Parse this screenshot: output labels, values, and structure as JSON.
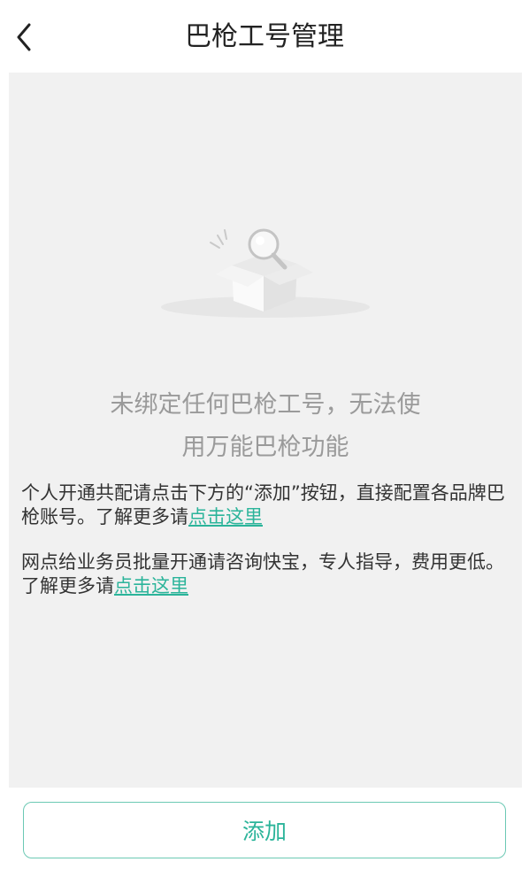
{
  "header": {
    "title": "巴枪工号管理",
    "back_icon": "chevron-left-icon"
  },
  "empty_state": {
    "illustration_icon": "empty-box-search-icon",
    "message_line1": "未绑定任何巴枪工号，无法使",
    "message_line2": "用万能巴枪功能"
  },
  "info": [
    {
      "text": "个人开通共配请点击下方的“添加”按钮，直接配置各品牌巴枪账号。了解更多请",
      "link": "点击这里"
    },
    {
      "text": "网点给业务员批量开通请咨询快宝，专人指导，费用更低。了解更多请",
      "link": "点击这里"
    }
  ],
  "footer": {
    "add_label": "添加"
  },
  "colors": {
    "accent": "#2bb49a",
    "button_border": "#6cc9b4",
    "content_bg": "#f1f1f1",
    "muted_text": "#9a9a9a"
  }
}
